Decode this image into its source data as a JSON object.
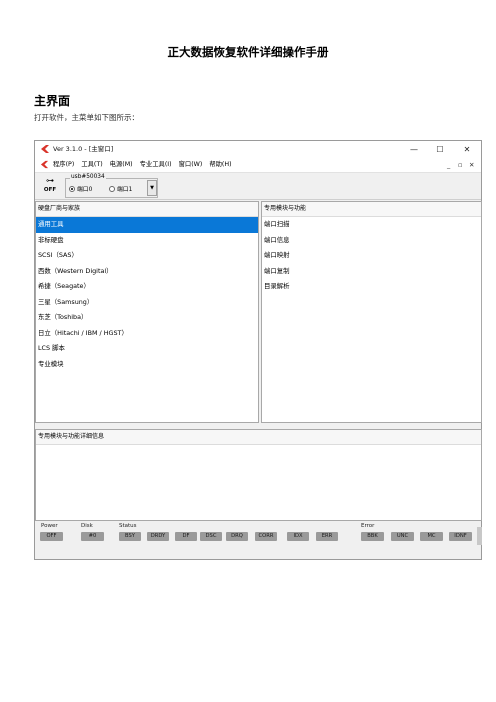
{
  "document": {
    "title": "正大数据恢复软件详细操作手册",
    "section": "主界面",
    "intro": "打开软件，主菜单如下图所示："
  },
  "window": {
    "title": "Ver 3.1.0 - [主窗口]",
    "controls": {
      "minimize": "—",
      "maximize": "☐",
      "close": "✕"
    },
    "mdi_controls": {
      "minimize": "_",
      "restore": "▫",
      "close": "✕"
    },
    "menu": [
      "程序(P)",
      "工具(T)",
      "电源(M)",
      "专业工具(I)",
      "窗口(W)",
      "帮助(H)"
    ]
  },
  "toolbar": {
    "power_label": "OFF",
    "device_group_label": "usb#50034",
    "port_options": [
      "端口0",
      "端口1"
    ],
    "port_selected": "端口0"
  },
  "left_pane": {
    "header": "硬盘厂商与家族",
    "items": [
      "通用工具",
      "非标硬盘",
      "SCSI（SAS）",
      "西数（Western Digital）",
      "希捷（Seagate）",
      "三星（Samsung）",
      "东芝（Toshiba）",
      "日立（Hitachi / IBM / HGST）",
      "LCS 脚本",
      "专业模块"
    ],
    "selected_index": 0
  },
  "right_pane": {
    "header": "专用模块与功能",
    "items": [
      "端口扫描",
      "端口信息",
      "端口映射",
      "端口复制",
      "目录解析"
    ]
  },
  "detail_pane": {
    "header": "专用模块与功能详细信息"
  },
  "statusbar": {
    "power": {
      "label": "Power",
      "value": "OFF"
    },
    "disk": {
      "label": "Disk",
      "value": "#0"
    },
    "status": {
      "label": "Status",
      "flags": [
        "BSY",
        "DRDY",
        "DF",
        "DSC",
        "DRQ",
        "CORR",
        "IDX",
        "ERR"
      ]
    },
    "error": {
      "label": "Error",
      "flags": [
        "BBK",
        "UNC",
        "MC",
        "IDNF"
      ]
    }
  },
  "colors": {
    "selection": "#0a78d7",
    "badge": "#9a9a9a",
    "app_icon": "#d9342b"
  }
}
